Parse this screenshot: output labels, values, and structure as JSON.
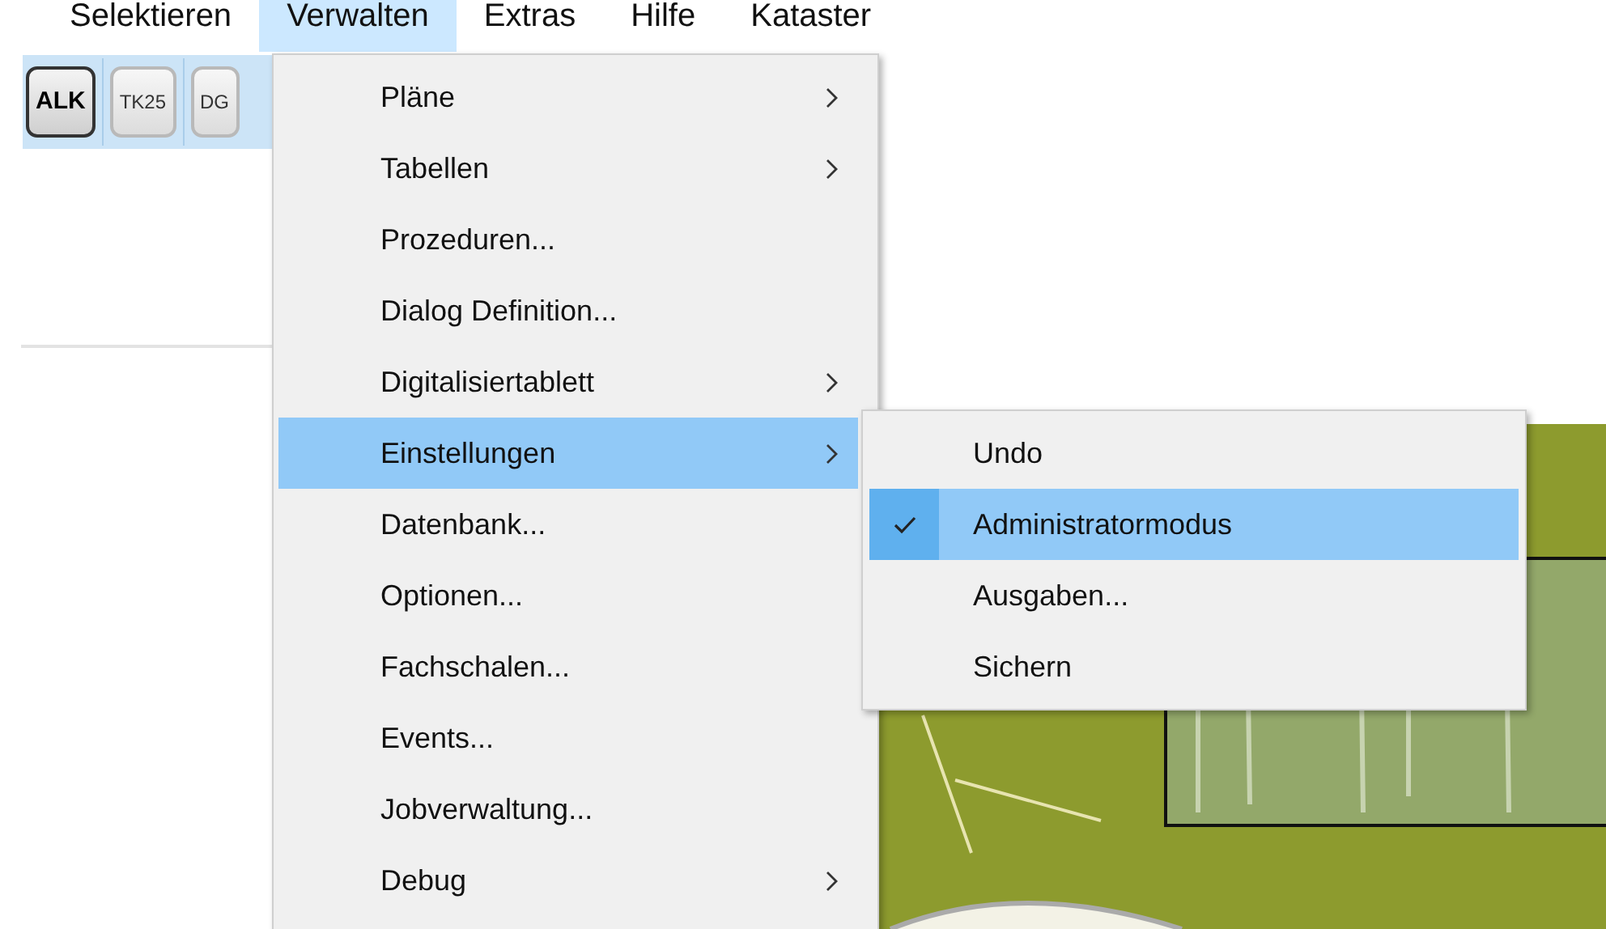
{
  "menubar": [
    {
      "label": "Selektieren",
      "selected": false
    },
    {
      "label": "Verwalten",
      "selected": true
    },
    {
      "label": "Extras",
      "selected": false
    },
    {
      "label": "Hilfe",
      "selected": false
    },
    {
      "label": "Kataster",
      "selected": false
    }
  ],
  "toolbar": [
    {
      "label": "ALK",
      "selected": true
    },
    {
      "label": "TK25",
      "selected": false
    },
    {
      "label": "DG",
      "selected": false
    }
  ],
  "menu": {
    "items": [
      {
        "label": "Pläne",
        "submenu": true,
        "highlighted": false
      },
      {
        "label": "Tabellen",
        "submenu": true,
        "highlighted": false
      },
      {
        "label": "Prozeduren...",
        "submenu": false,
        "highlighted": false
      },
      {
        "label": "Dialog Definition...",
        "submenu": false,
        "highlighted": false
      },
      {
        "label": "Digitalisiertablett",
        "submenu": true,
        "highlighted": false
      },
      {
        "label": "Einstellungen",
        "submenu": true,
        "highlighted": true
      },
      {
        "label": "Datenbank...",
        "submenu": false,
        "highlighted": false
      },
      {
        "label": "Optionen...",
        "submenu": false,
        "highlighted": false
      },
      {
        "label": "Fachschalen...",
        "submenu": false,
        "highlighted": false
      },
      {
        "label": "Events...",
        "submenu": false,
        "highlighted": false
      },
      {
        "label": "Jobverwaltung...",
        "submenu": false,
        "highlighted": false
      },
      {
        "label": "Debug",
        "submenu": true,
        "highlighted": false
      }
    ]
  },
  "submenu": {
    "items": [
      {
        "label": "Undo",
        "checked": false,
        "highlighted": false
      },
      {
        "label": "Administratormodus",
        "checked": true,
        "highlighted": true
      },
      {
        "label": "Ausgaben...",
        "checked": false,
        "highlighted": false
      },
      {
        "label": "Sichern",
        "checked": false,
        "highlighted": false
      }
    ]
  }
}
